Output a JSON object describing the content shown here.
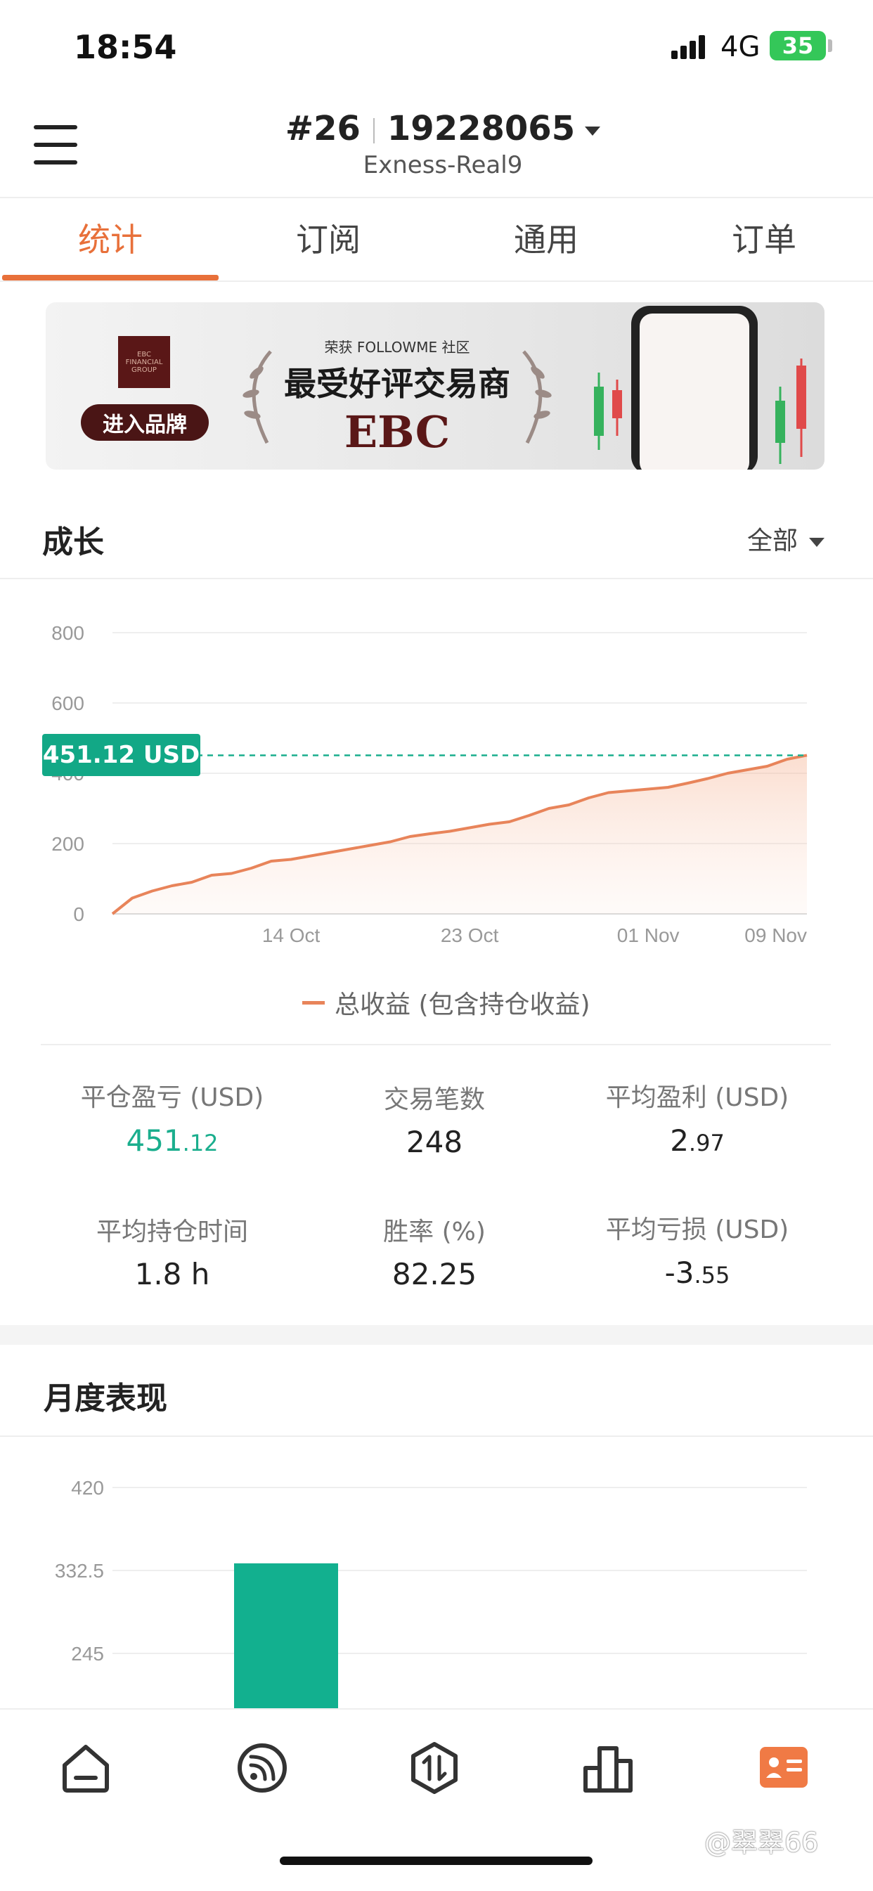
{
  "status_bar": {
    "time": "18:54",
    "network": "4G",
    "battery": "35"
  },
  "header": {
    "rank": "#26",
    "account": "19228065",
    "server": "Exness-Real9"
  },
  "tabs": [
    {
      "label": "统计",
      "active": true
    },
    {
      "label": "订阅",
      "active": false
    },
    {
      "label": "通用",
      "active": false
    },
    {
      "label": "订单",
      "active": false
    }
  ],
  "banner": {
    "brand_button": "进入品牌",
    "subtitle": "荣获 FOLLOWME 社区",
    "title": "最受好评交易商",
    "brand": "EBC",
    "logo_text": "EBC FINANCIAL GROUP"
  },
  "growth": {
    "title": "成长",
    "filter": "全部",
    "current_label": "451.12 USD",
    "legend": "总收益 (包含持仓收益)"
  },
  "chart_data": [
    {
      "type": "area",
      "x_ticks": [
        "14 Oct",
        "23 Oct",
        "01 Nov",
        "09 Nov"
      ],
      "y_ticks": [
        0,
        200,
        400,
        600,
        800
      ],
      "ylim": [
        0,
        800
      ],
      "grid": true,
      "series": [
        {
          "name": "总收益 (包含持仓收益)",
          "color": "#e8845a",
          "points": [
            [
              "05 Oct",
              0
            ],
            [
              "06 Oct",
              45
            ],
            [
              "07 Oct",
              65
            ],
            [
              "08 Oct",
              80
            ],
            [
              "09 Oct",
              90
            ],
            [
              "10 Oct",
              110
            ],
            [
              "11 Oct",
              115
            ],
            [
              "12 Oct",
              130
            ],
            [
              "13 Oct",
              150
            ],
            [
              "14 Oct",
              155
            ],
            [
              "15 Oct",
              165
            ],
            [
              "16 Oct",
              175
            ],
            [
              "17 Oct",
              185
            ],
            [
              "18 Oct",
              195
            ],
            [
              "19 Oct",
              205
            ],
            [
              "20 Oct",
              220
            ],
            [
              "21 Oct",
              228
            ],
            [
              "22 Oct",
              235
            ],
            [
              "23 Oct",
              245
            ],
            [
              "24 Oct",
              255
            ],
            [
              "25 Oct",
              262
            ],
            [
              "26 Oct",
              280
            ],
            [
              "27 Oct",
              300
            ],
            [
              "28 Oct",
              310
            ],
            [
              "29 Oct",
              330
            ],
            [
              "30 Oct",
              345
            ],
            [
              "31 Oct",
              350
            ],
            [
              "01 Nov",
              355
            ],
            [
              "02 Nov",
              360
            ],
            [
              "03 Nov",
              372
            ],
            [
              "04 Nov",
              385
            ],
            [
              "05 Nov",
              400
            ],
            [
              "06 Nov",
              410
            ],
            [
              "07 Nov",
              420
            ],
            [
              "08 Nov",
              440
            ],
            [
              "09 Nov",
              451.12
            ]
          ]
        }
      ],
      "reference_line": {
        "value": 451.12,
        "color": "#1aae8d",
        "style": "dashed"
      }
    },
    {
      "type": "bar",
      "y_ticks": [
        245,
        332.5,
        420
      ],
      "ylim": [
        200,
        420
      ],
      "grid": true,
      "bars": [
        {
          "value": 340,
          "color": "#12b08f"
        }
      ]
    }
  ],
  "stats": {
    "closed_pl": {
      "label": "平仓盈亏 (USD)",
      "int": "451",
      "dec": ".12"
    },
    "trades": {
      "label": "交易笔数",
      "value": "248"
    },
    "avg_profit": {
      "label": "平均盈利 (USD)",
      "int": "2",
      "dec": ".97"
    },
    "avg_hold": {
      "label": "平均持仓时间",
      "value": "1.8 h"
    },
    "win_rate": {
      "label": "胜率 (%)",
      "value": "82.25"
    },
    "avg_loss": {
      "label": "平均亏损 (USD)",
      "int": "-3",
      "dec": ".55"
    }
  },
  "monthly": {
    "title": "月度表现"
  },
  "bottom_nav": [
    {
      "icon": "home-icon"
    },
    {
      "icon": "feed-icon"
    },
    {
      "icon": "trade-icon"
    },
    {
      "icon": "ranking-icon"
    },
    {
      "icon": "profile-card-icon",
      "active": true
    }
  ],
  "watermark": "@翠翠66",
  "colors": {
    "accent": "#e8703a",
    "green": "#1aae8d"
  }
}
